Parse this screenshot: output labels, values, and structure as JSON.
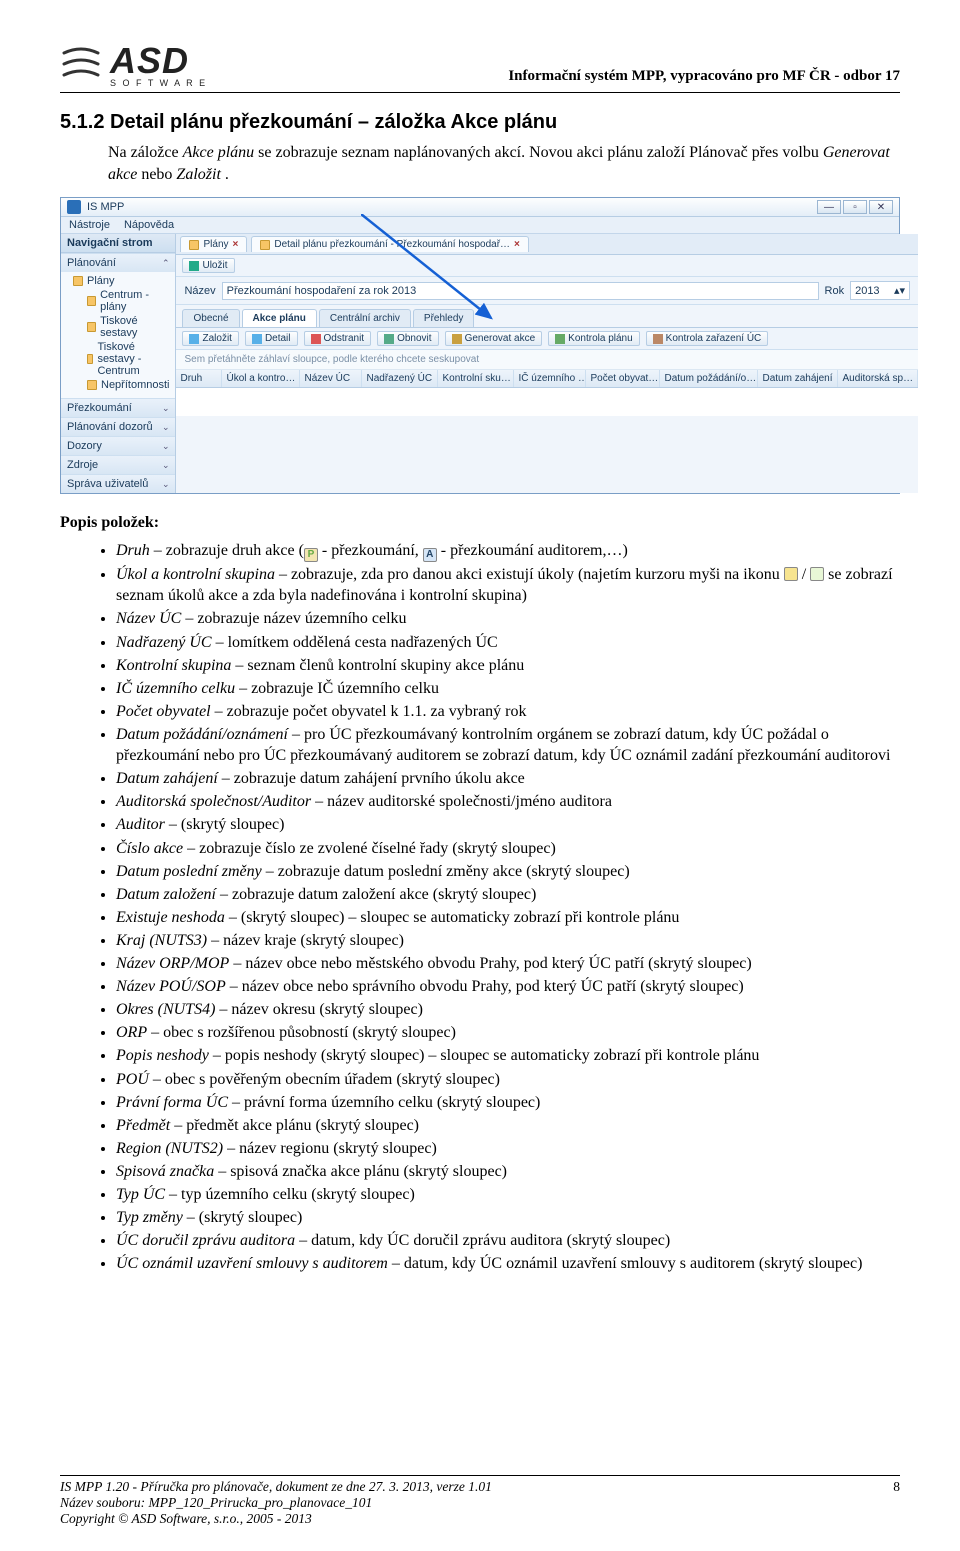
{
  "header": {
    "logo_text": "ASD",
    "logo_sub": "S O F T W A R E",
    "doc_meta": "Informační systém MPP, vypracováno pro MF ČR - odbor 17"
  },
  "section": {
    "number_title": "5.1.2  Detail plánu přezkoumání – záložka Akce plánu",
    "intro_1a": "Na záložce ",
    "intro_1b": "Akce plánu",
    "intro_1c": " se zobrazuje seznam naplánovaných akcí. Novou akci plánu založí Plánovač přes volbu ",
    "intro_1d": "Generovat akce",
    "intro_1e": " nebo ",
    "intro_1f": "Založit",
    "intro_1g": "."
  },
  "app": {
    "title": "IS MPP",
    "menu": {
      "nastroje": "Nástroje",
      "napoveda": "Nápověda"
    },
    "nav": {
      "header": "Navigační strom",
      "cat_plan": "Plánování",
      "items": [
        "Plány",
        "Centrum - plány",
        "Tiskové sestavy",
        "Tiskové sestavy - Centrum",
        "Nepřítomnosti"
      ],
      "cat_prez": "Přezkoumání",
      "cat_doz": "Plánování dozorů",
      "cat_dozory": "Dozory",
      "cat_zdroje": "Zdroje",
      "cat_sprava": "Správa uživatelů"
    },
    "tabs": {
      "plany": "Plány",
      "detail": "Detail plánu přezkoumání - Přezkoumání hospodař…"
    },
    "save_row": {
      "ulozit": "Uložit"
    },
    "form": {
      "nazev_label": "Název",
      "nazev_value": "Přezkoumání hospodaření za rok 2013",
      "rok_label": "Rok",
      "rok_value": "2013"
    },
    "inner_tabs": {
      "obecne": "Obecné",
      "akce": "Akce plánu",
      "archiv": "Centrální archiv",
      "prehledy": "Přehledy"
    },
    "toolbar": {
      "zalozit": "Založit",
      "detail": "Detail",
      "odstranit": "Odstranit",
      "obnovit": "Obnovit",
      "generovat": "Generovat akce",
      "kontrola_planu": "Kontrola plánu",
      "kontrola_uc": "Kontrola zařazení ÚC"
    },
    "group_hint": "Sem přetáhněte záhlaví sloupce, podle kterého chcete seskupovat",
    "grid_cols": [
      "Druh",
      "Úkol a kontro…",
      "Název ÚC",
      "Nadřazený ÚC",
      "Kontrolní sku…",
      "IČ územního …",
      "Počet obyvat…",
      "Datum požádání/o…",
      "Datum zahájení",
      "Auditorská sp…"
    ]
  },
  "defs": {
    "title": "Popis položek:",
    "items": [
      {
        "term": "Druh",
        "text": " – zobrazuje druh akce (",
        "icon1": "P",
        "mid": " - přezkoumání, ",
        "icon2": "A",
        "tail": " - přezkoumání auditorem,…)"
      },
      {
        "term": "Úkol a kontrolní skupina",
        "text": " – zobrazuje, zda pro danou akci existují úkoly (najetím kurzoru myši na ikonu ",
        "icon1": "y",
        "mid": " / ",
        "icon2": "t",
        "tail": " se zobrazí seznam úkolů akce a zda byla nadefinována i kontrolní skupina)"
      },
      {
        "term": "Název ÚC",
        "text": " – zobrazuje název územního celku"
      },
      {
        "term": "Nadřazený ÚC",
        "text": " – lomítkem oddělená cesta nadřazených ÚC"
      },
      {
        "term": "Kontrolní skupina",
        "text": " – seznam členů kontrolní skupiny akce plánu"
      },
      {
        "term": "IČ územního celku",
        "text": " – zobrazuje IČ územního celku"
      },
      {
        "term": "Počet obyvatel",
        "text": " – zobrazuje počet obyvatel k 1.1. za vybraný rok"
      },
      {
        "term": "Datum požádání/oznámení",
        "text": " – pro ÚC přezkoumávaný kontrolním orgánem se zobrazí datum, kdy ÚC požádal o přezkoumání nebo pro ÚC přezkoumávaný auditorem se zobrazí datum, kdy ÚC oznámil zadání přezkoumání auditorovi"
      },
      {
        "term": "Datum zahájení",
        "text": " – zobrazuje datum zahájení prvního úkolu akce"
      },
      {
        "term": "Auditorská společnost/Auditor",
        "text": " – název auditorské společnosti/jméno auditora"
      },
      {
        "term": "Auditor",
        "text": " – (skrytý sloupec)"
      },
      {
        "term": "Číslo akce",
        "text": " – zobrazuje číslo ze zvolené číselné řady (skrytý sloupec)"
      },
      {
        "term": "Datum poslední změny",
        "text": " – zobrazuje datum poslední změny akce (skrytý sloupec)"
      },
      {
        "term": "Datum založení",
        "text": " – zobrazuje datum založení akce (skrytý sloupec)"
      },
      {
        "term": "Existuje neshoda",
        "text": " – (skrytý sloupec) – sloupec se automaticky zobrazí při kontrole plánu"
      },
      {
        "term": "Kraj (NUTS3)",
        "text": " – název kraje (skrytý sloupec)"
      },
      {
        "term": "Název ORP/MOP",
        "text": " – název obce nebo městského obvodu Prahy, pod který ÚC patří (skrytý sloupec)"
      },
      {
        "term": "Název POÚ/SOP",
        "text": " – název obce nebo správního obvodu Prahy, pod který ÚC patří (skrytý sloupec)"
      },
      {
        "term": "Okres (NUTS4)",
        "text": " – název okresu (skrytý sloupec)"
      },
      {
        "term": "ORP",
        "text": " – obec s rozšířenou působností (skrytý sloupec)"
      },
      {
        "term": "Popis neshody",
        "text": " – popis neshody (skrytý sloupec) – sloupec se automaticky zobrazí při kontrole plánu"
      },
      {
        "term": "POÚ",
        "text": " – obec s pověřeným obecním úřadem (skrytý sloupec)"
      },
      {
        "term": "Právní forma ÚC",
        "text": " – právní forma územního celku (skrytý sloupec)"
      },
      {
        "term": "Předmět",
        "text": " – předmět akce plánu (skrytý sloupec)"
      },
      {
        "term": "Region (NUTS2)",
        "text": " – název regionu (skrytý sloupec)"
      },
      {
        "term": "Spisová značka",
        "text": " – spisová značka akce plánu (skrytý sloupec)"
      },
      {
        "term": "Typ ÚC",
        "text": " – typ územního celku (skrytý sloupec)"
      },
      {
        "term": "Typ změny",
        "text": " – (skrytý sloupec)"
      },
      {
        "term": "ÚC doručil zprávu auditora",
        "text": " – datum, kdy ÚC doručil zprávu auditora (skrytý sloupec)"
      },
      {
        "term": "ÚC oznámil uzavření smlouvy s auditorem",
        "text": " – datum, kdy ÚC oznámil uzavření smlouvy s auditorem (skrytý sloupec)"
      }
    ]
  },
  "footer": {
    "line1": "IS MPP 1.20 - Příručka pro plánovače, dokument ze dne 27. 3. 2013, verze 1.01",
    "line2": "Název souboru: MPP_120_Prirucka_pro_planovace_101",
    "line3": "Copyright © ASD Software, s.r.o., 2005 - 2013",
    "page": "8"
  }
}
